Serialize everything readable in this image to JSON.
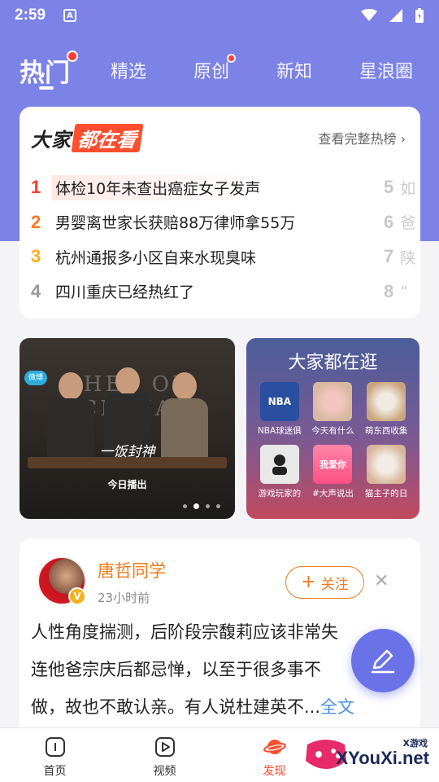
{
  "status_bar": {
    "time": "2:59",
    "a_label": "A"
  },
  "tabs": [
    {
      "label": "热门",
      "active": true,
      "dot": true
    },
    {
      "label": "精选",
      "active": false,
      "dot": false
    },
    {
      "label": "原创",
      "active": false,
      "dot": true
    },
    {
      "label": "新知",
      "active": false,
      "dot": false
    },
    {
      "label": "星浪圈",
      "active": false,
      "dot": false
    }
  ],
  "hot_card": {
    "logo_black": "大家",
    "logo_red": "都在看",
    "more_label": "查看完整热榜 ›",
    "items": [
      {
        "rank": "1",
        "text": "体检10年未查出癌症女子发声"
      },
      {
        "rank": "2",
        "text": "男婴离世家长获赔88万律师拿55万"
      },
      {
        "rank": "3",
        "text": "杭州通报多小区自来水现臭味"
      },
      {
        "rank": "4",
        "text": "四川重庆已经热红了"
      }
    ],
    "peek_items": [
      {
        "rank": "5",
        "text": "如"
      },
      {
        "rank": "6",
        "text": "爸"
      },
      {
        "rank": "7",
        "text": "陕"
      },
      {
        "rank": "8",
        "text": "“"
      }
    ]
  },
  "banner_left": {
    "bg_text": "CHEF OF CHINA",
    "logo": "微博",
    "title": "一饭封神",
    "subtitle": "今日播出"
  },
  "banner_right": {
    "title": "大家都在逛",
    "items": [
      {
        "label": "NBA球迷俱",
        "thumb": "NBA",
        "color": "#2b4fa0"
      },
      {
        "label": "今天有什么",
        "thumb": "",
        "color": "#d9b8a2"
      },
      {
        "label": "萌东西收集",
        "thumb": "",
        "color": "#c9a57e"
      },
      {
        "label": "游戏玩家的",
        "thumb": "",
        "color": "#e8e8e8"
      },
      {
        "label": "#大声说出",
        "thumb": "我爱你",
        "color": "#ff5b8c"
      },
      {
        "label": "猫主子的日",
        "thumb": "",
        "color": "#d7b49a"
      }
    ]
  },
  "feed_card": {
    "author": "唐哲同学",
    "time": "23小时前",
    "follow_label": "关注",
    "badge": "V",
    "text_lines": [
      "人性角度揣测，后阶段宗馥莉应该非常失",
      "连他爸宗庆后都忌惮，以至于很多事不",
      "做，故也不敢认亲。有人说杜建英不..."
    ],
    "more_label": "全文"
  },
  "bottom_nav": [
    {
      "label": "首页",
      "icon": "home-icon",
      "active": false
    },
    {
      "label": "视频",
      "icon": "video-icon",
      "active": false
    },
    {
      "label": "发现",
      "icon": "discover-planet-icon",
      "active": true
    },
    {
      "label": "",
      "icon": "message-icon",
      "active": false
    }
  ],
  "watermark": {
    "top": "X游戏",
    "text": "XYouXi.net"
  },
  "colors": {
    "primary": "#7c82e6",
    "accent": "#ff4d2e",
    "orange": "#f07a1a",
    "link": "#4a8ee0"
  }
}
